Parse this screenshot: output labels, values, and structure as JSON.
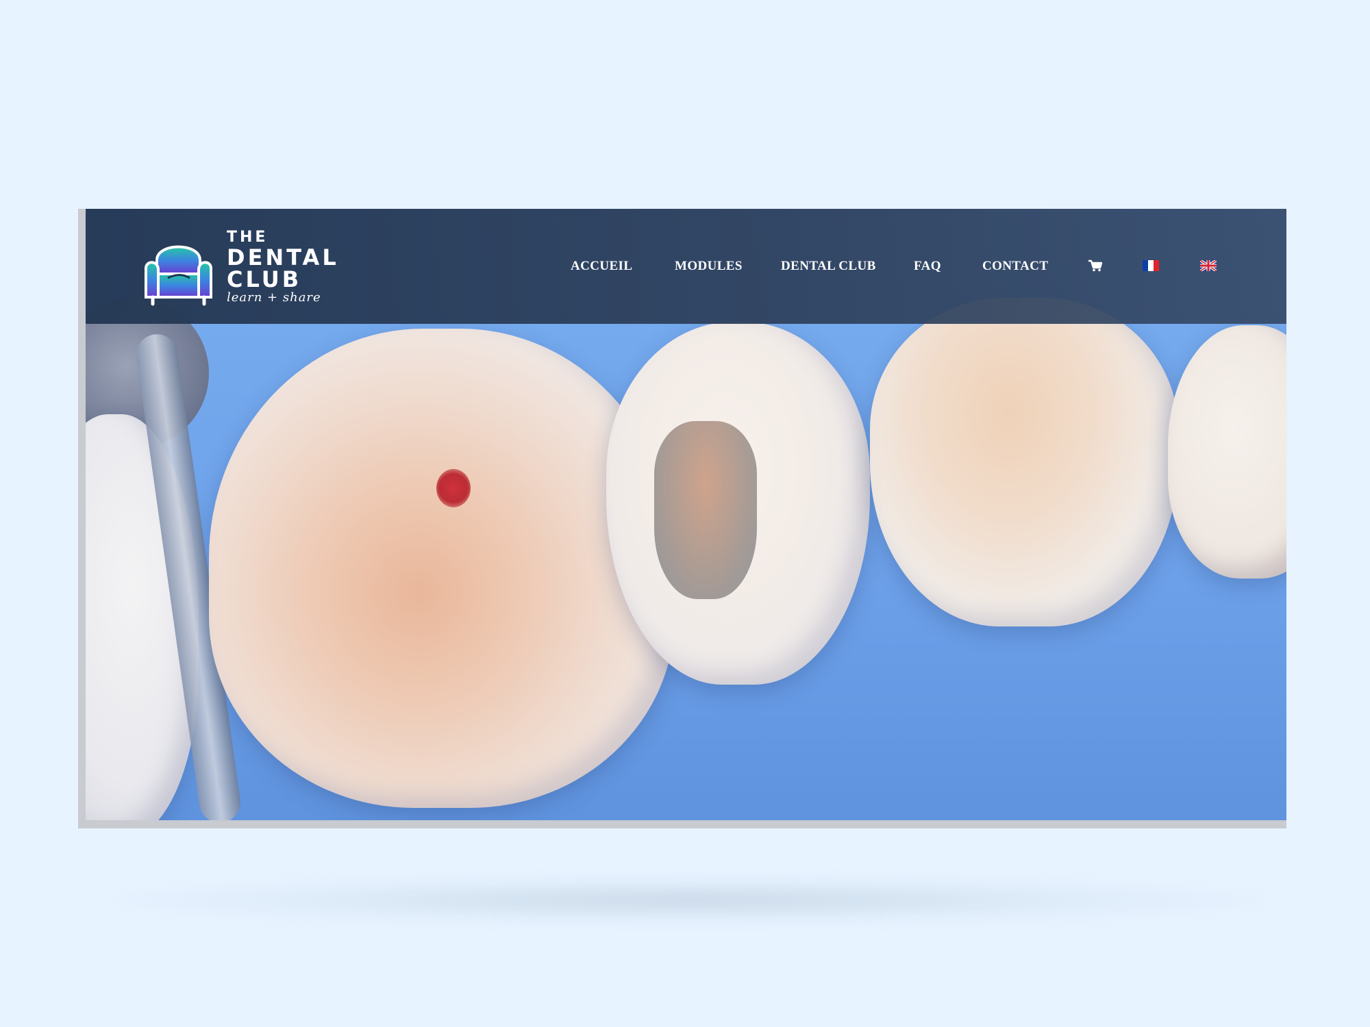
{
  "site": {
    "logo": {
      "the": "THE",
      "dental": "DENTAL",
      "club": "CLUB",
      "tagline": "learn + share"
    },
    "nav": {
      "items": [
        {
          "label": "ACCUEIL"
        },
        {
          "label": "MODULES"
        },
        {
          "label": "DENTAL CLUB"
        },
        {
          "label": "FAQ"
        },
        {
          "label": "CONTACT"
        }
      ],
      "cart_icon": "cart-icon",
      "languages": [
        {
          "icon": "flag-fr-icon",
          "colors": [
            "#0b3fa8",
            "#ffffff",
            "#e2222b"
          ]
        },
        {
          "icon": "flag-uk-icon",
          "colors": [
            "#1f3f94",
            "#ffffff",
            "#d22333"
          ]
        }
      ]
    },
    "hero": {
      "image": "dental-close-up-photo"
    }
  },
  "colors": {
    "background": "#e7f3ff",
    "header": "#243854",
    "hero_blue": "#6fa5ea",
    "logo_gradient": [
      "#22c1a6",
      "#3b8be0",
      "#6b3fd1"
    ]
  }
}
